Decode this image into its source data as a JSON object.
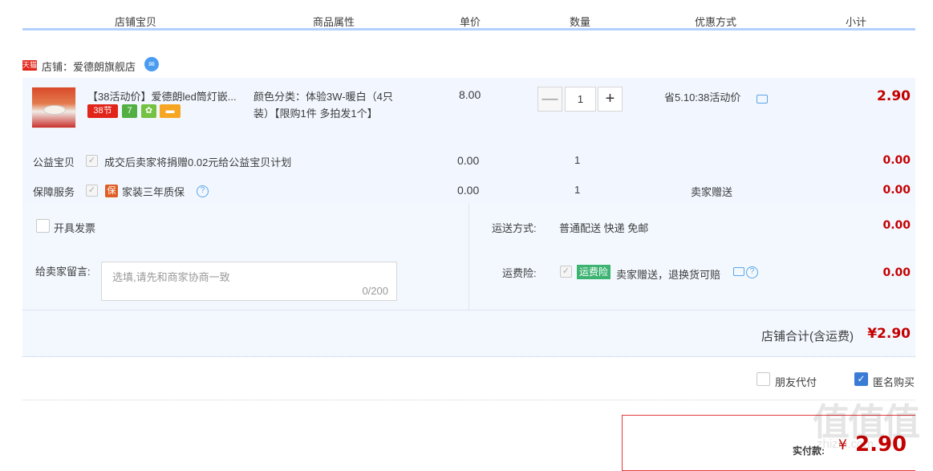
{
  "headers": [
    "店铺宝贝",
    "商品属性",
    "单价",
    "数量",
    "优惠方式",
    "小计"
  ],
  "shop": {
    "badge": "天猫",
    "name": "店铺：爱德朗旗舰店"
  },
  "item": {
    "title": "【38活动价】爱德朗led筒灯嵌...",
    "badges": [
      "38节",
      "7",
      "",
      ""
    ],
    "props_line1": "颜色分类：体验3W-暖白（4只",
    "props_line2": "装）【限购1件 多拍发1个】",
    "price": "8.00",
    "quantity": "1",
    "qty_minus": "—",
    "qty_plus": "+",
    "discount": "省5.10:38活动价",
    "subtotal": "2.90"
  },
  "charity": {
    "label": "公益宝贝",
    "check": "✓",
    "text": "成交后卖家将捐赠0.02元给公益宝贝计划",
    "price": "0.00",
    "qty": "1",
    "subtotal": "0.00"
  },
  "guarantee": {
    "label": "保障服务",
    "check": "✓",
    "icon_text": "保",
    "text": "家装三年质保",
    "help": "?",
    "price": "0.00",
    "qty": "1",
    "discount": "卖家赠送",
    "subtotal": "0.00"
  },
  "invoice": {
    "label": "开具发票"
  },
  "shipping": {
    "label": "运送方式:",
    "value": "普通配送 快递 免邮",
    "cost": "0.00"
  },
  "message": {
    "label": "给卖家留言:",
    "placeholder": "选填,请先和商家协商一致",
    "counter": "0/200"
  },
  "insurance": {
    "label": "运费险:",
    "check": "✓",
    "badge": "运费险",
    "text": "卖家赠送，退换货可赔",
    "help": "?",
    "cost": "0.00"
  },
  "shop_total": {
    "label": "店铺合计(含运费)",
    "value": "¥2.90"
  },
  "options": {
    "friend_pay": "朋友代付",
    "anonymous": "匿名购买",
    "anonymous_check": "✓"
  },
  "pay": {
    "label": "实付款:",
    "yen": "¥",
    "value": "2.90"
  },
  "watermark": {
    "main": "值值值",
    "sub": "zhizhi.com"
  },
  "colors": {
    "price_red": "#c40000",
    "header_border": "#b2d1ff",
    "row_bg": "#f2f7ff",
    "tmall_red": "#e1251b",
    "link_blue": "#5aa4e6"
  }
}
